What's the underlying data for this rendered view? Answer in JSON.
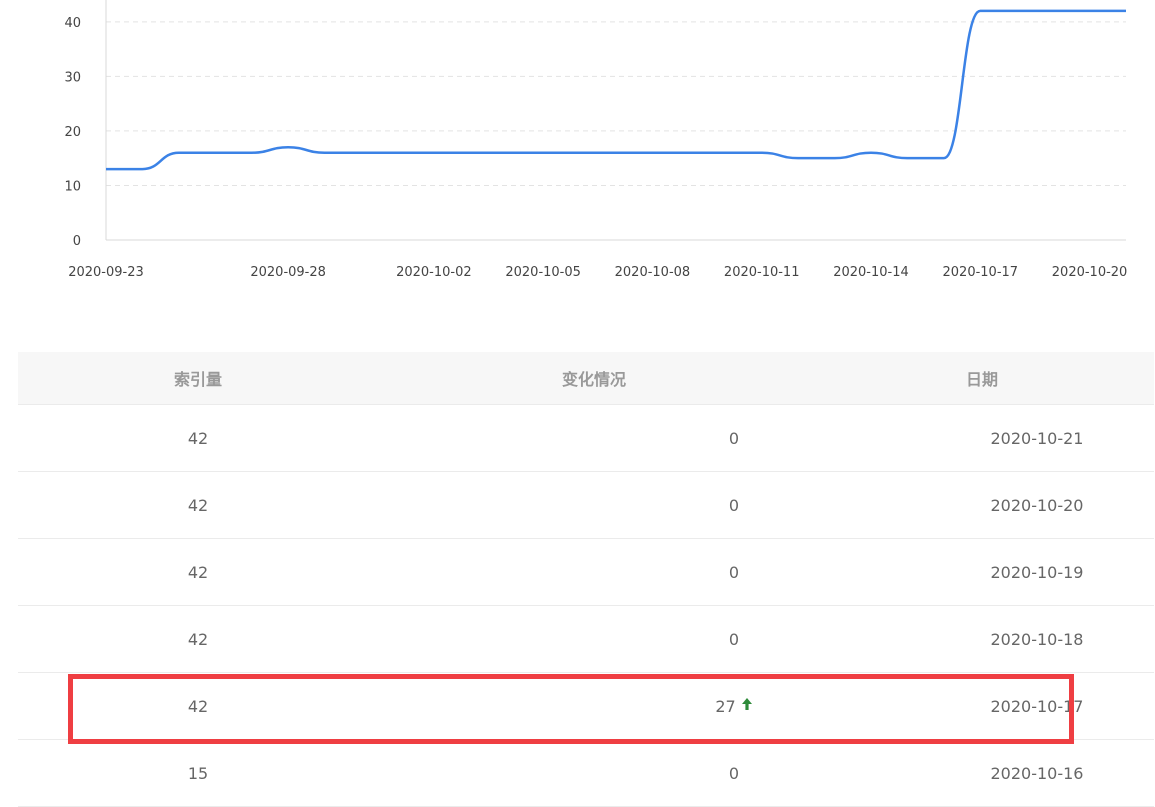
{
  "chart_data": {
    "type": "line",
    "x": [
      "2020-09-23",
      "2020-09-24",
      "2020-09-25",
      "2020-09-26",
      "2020-09-27",
      "2020-09-28",
      "2020-09-29",
      "2020-09-30",
      "2020-10-01",
      "2020-10-02",
      "2020-10-03",
      "2020-10-04",
      "2020-10-05",
      "2020-10-06",
      "2020-10-07",
      "2020-10-08",
      "2020-10-09",
      "2020-10-10",
      "2020-10-11",
      "2020-10-12",
      "2020-10-13",
      "2020-10-14",
      "2020-10-15",
      "2020-10-16",
      "2020-10-17",
      "2020-10-18",
      "2020-10-19",
      "2020-10-20",
      "2020-10-21"
    ],
    "series": [
      {
        "values": [
          13,
          13,
          16,
          16,
          16,
          17,
          16,
          16,
          16,
          16,
          16,
          16,
          16,
          16,
          16,
          16,
          16,
          16,
          16,
          15,
          15,
          16,
          15,
          15,
          42,
          42,
          42,
          42,
          42
        ],
        "color": "#3b82e6"
      }
    ],
    "x_tick_labels": [
      "2020-09-23",
      "2020-09-28",
      "2020-10-02",
      "2020-10-05",
      "2020-10-08",
      "2020-10-11",
      "2020-10-14",
      "2020-10-17",
      "2020-10-20"
    ],
    "y_ticks": [
      0,
      10,
      20,
      30,
      40
    ],
    "ylim": [
      0,
      44
    ],
    "grid": "horizontal-dashed"
  },
  "table": {
    "headers": {
      "index": "索引量",
      "change": "变化情况",
      "date": "日期"
    },
    "rows": [
      {
        "index": "42",
        "change": "0",
        "date": "2020-10-21",
        "up": false
      },
      {
        "index": "42",
        "change": "0",
        "date": "2020-10-20",
        "up": false
      },
      {
        "index": "42",
        "change": "0",
        "date": "2020-10-19",
        "up": false
      },
      {
        "index": "42",
        "change": "0",
        "date": "2020-10-18",
        "up": false
      },
      {
        "index": "42",
        "change": "27",
        "date": "2020-10-17",
        "up": true,
        "up_icon": "🠕"
      },
      {
        "index": "15",
        "change": "0",
        "date": "2020-10-16",
        "up": false
      }
    ]
  },
  "colors": {
    "line": "#3b82e6",
    "highlight": "#ef3e42",
    "up_arrow": "#2e8b3a"
  }
}
